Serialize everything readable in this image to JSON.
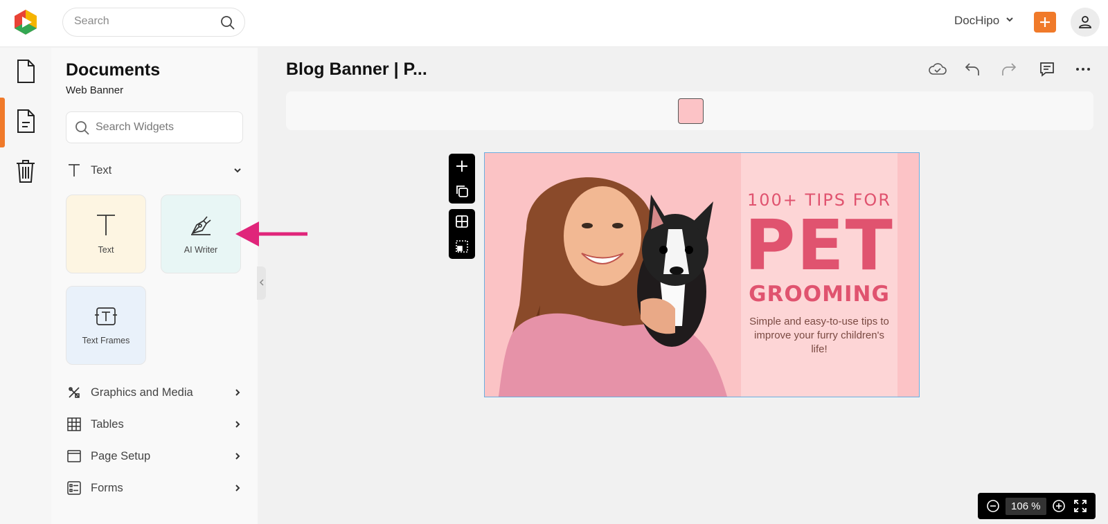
{
  "topbar": {
    "search_placeholder": "Search",
    "account_name": "DocHipo",
    "brand_color": "#f07a2a"
  },
  "rail": {
    "items": [
      {
        "icon": "document-icon",
        "active": false
      },
      {
        "icon": "document-text-icon",
        "active": true
      },
      {
        "icon": "trash-icon",
        "active": false
      }
    ]
  },
  "panel": {
    "title": "Documents",
    "subtitle": "Web Banner",
    "search_placeholder": "Search Widgets",
    "sections": [
      {
        "label": "Text",
        "icon": "text-icon",
        "expanded": true
      },
      {
        "label": "Graphics and Media",
        "icon": "graphics-icon"
      },
      {
        "label": "Tables",
        "icon": "table-icon"
      },
      {
        "label": "Page Setup",
        "icon": "page-setup-icon"
      },
      {
        "label": "Forms",
        "icon": "forms-icon"
      }
    ],
    "tiles": [
      {
        "label": "Text",
        "icon": "text-icon",
        "bg": "#fdf5e2"
      },
      {
        "label": "AI Writer",
        "icon": "pen-nib-icon",
        "bg": "#e8f6f5"
      },
      {
        "label": "Text Frames",
        "icon": "text-frame-icon",
        "bg": "#e9f1fa"
      }
    ]
  },
  "workspace": {
    "doc_title": "Blog Banner | P...",
    "selected_color": "#fcc3c6",
    "zoom": "106 %"
  },
  "banner": {
    "line1": "100+ TIPS FOR",
    "line2": "PET",
    "line3": "GROOMING",
    "tagline": "Simple and easy-to-use tips to improve your furry children's life!"
  },
  "callout_color": "#e0257a"
}
